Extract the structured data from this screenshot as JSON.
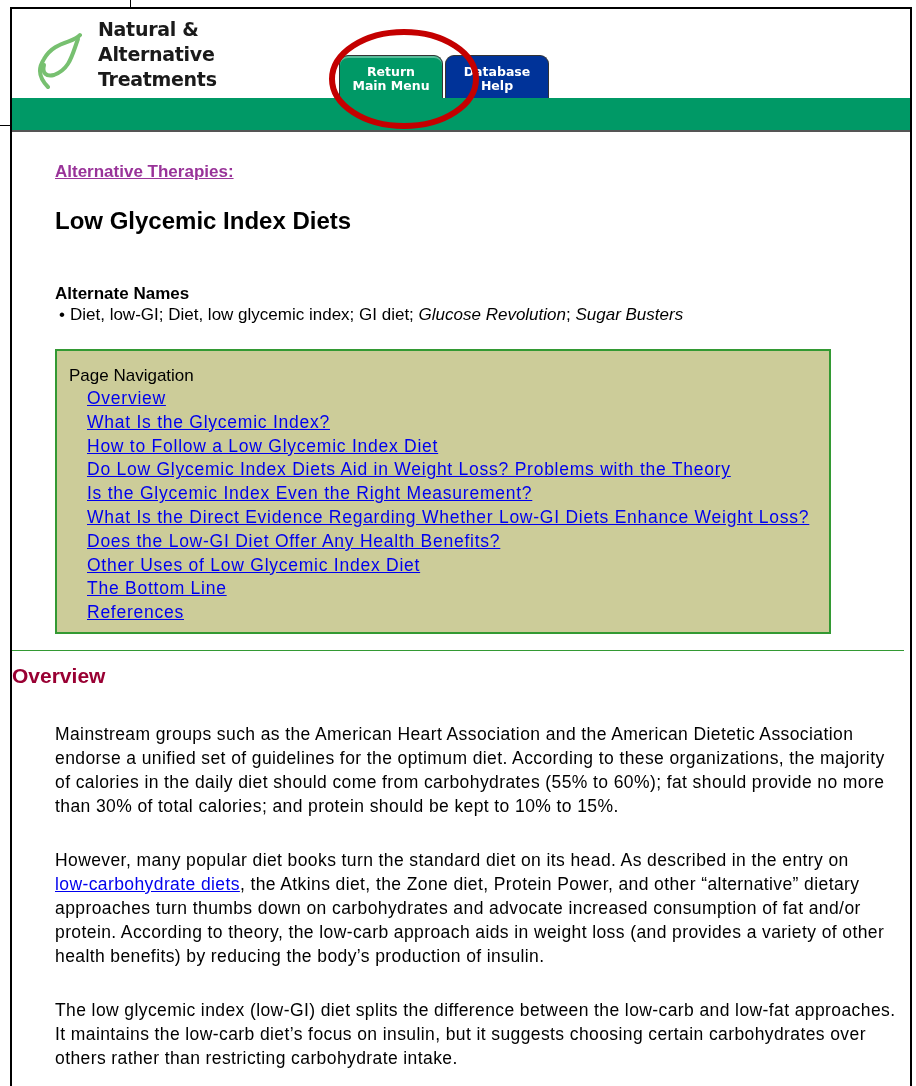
{
  "header": {
    "logo_text": [
      "Natural &",
      "Alternative",
      "Treatments"
    ],
    "tabs": [
      {
        "label": [
          "Return",
          "Main Menu"
        ],
        "kind": "green",
        "selected": true
      },
      {
        "label": [
          "Database",
          "Help"
        ],
        "kind": "blue",
        "selected": false
      }
    ]
  },
  "annotation": {
    "kind": "ellipse"
  },
  "breadcrumb": "Alternative Therapies:",
  "title": "Low Glycemic Index Diets",
  "alternate_names": {
    "heading": "Alternate Names",
    "bullet": "•",
    "text": "Diet, low-GI; Diet, low glycemic index; GI diet; *Glucose Revolution*; *Sugar Busters*"
  },
  "page_navigation": {
    "heading": "Page Navigation",
    "links": [
      "Overview",
      "What Is the Glycemic Index?",
      "How to Follow a Low Glycemic Index Diet",
      "Do Low Glycemic Index Diets Aid in Weight Loss? Problems with the Theory",
      "Is the Glycemic Index Even the Right Measurement?",
      "What Is the Direct Evidence Regarding Whether Low-GI Diets Enhance Weight Loss?",
      "Does the Low-GI Diet Offer Any Health Benefits?",
      "Other Uses of Low Glycemic Index Diet",
      "The Bottom Line",
      "References"
    ]
  },
  "section": {
    "heading": "Overview",
    "paragraphs": [
      [
        {
          "kind": "text",
          "text": "Mainstream groups such as the American Heart Association and the American Dietetic Association endorse a unified set of guidelines for the optimum diet. According to these organizations, the majority of calories in the daily diet should come from carbohydrates (55% to 60%); fat should provide no more than 30% of total calories; and protein should be kept to 10% to 15%."
        }
      ],
      [
        {
          "kind": "text",
          "text": "However, many popular diet books turn the standard diet on its head. As described in the entry on "
        },
        {
          "kind": "link",
          "text": "low-carbohydrate diets"
        },
        {
          "kind": "text",
          "text": ", the Atkins diet, the Zone diet, Protein Power, and other “alternative” dietary approaches turn thumbs down on carbohydrates and advocate increased consumption of fat and/or protein. According to theory, the low-carb approach aids in weight loss (and provides a variety of other health benefits) by reducing the body’s production of insulin."
        }
      ],
      [
        {
          "kind": "text",
          "text": "The low glycemic index (low-GI) diet splits the difference between the low-carb and low-fat approaches. It maintains the low-carb diet’s focus on insulin, but it suggests choosing certain carbohydrates over others rather than restricting carbohydrate intake."
        }
      ]
    ]
  }
}
